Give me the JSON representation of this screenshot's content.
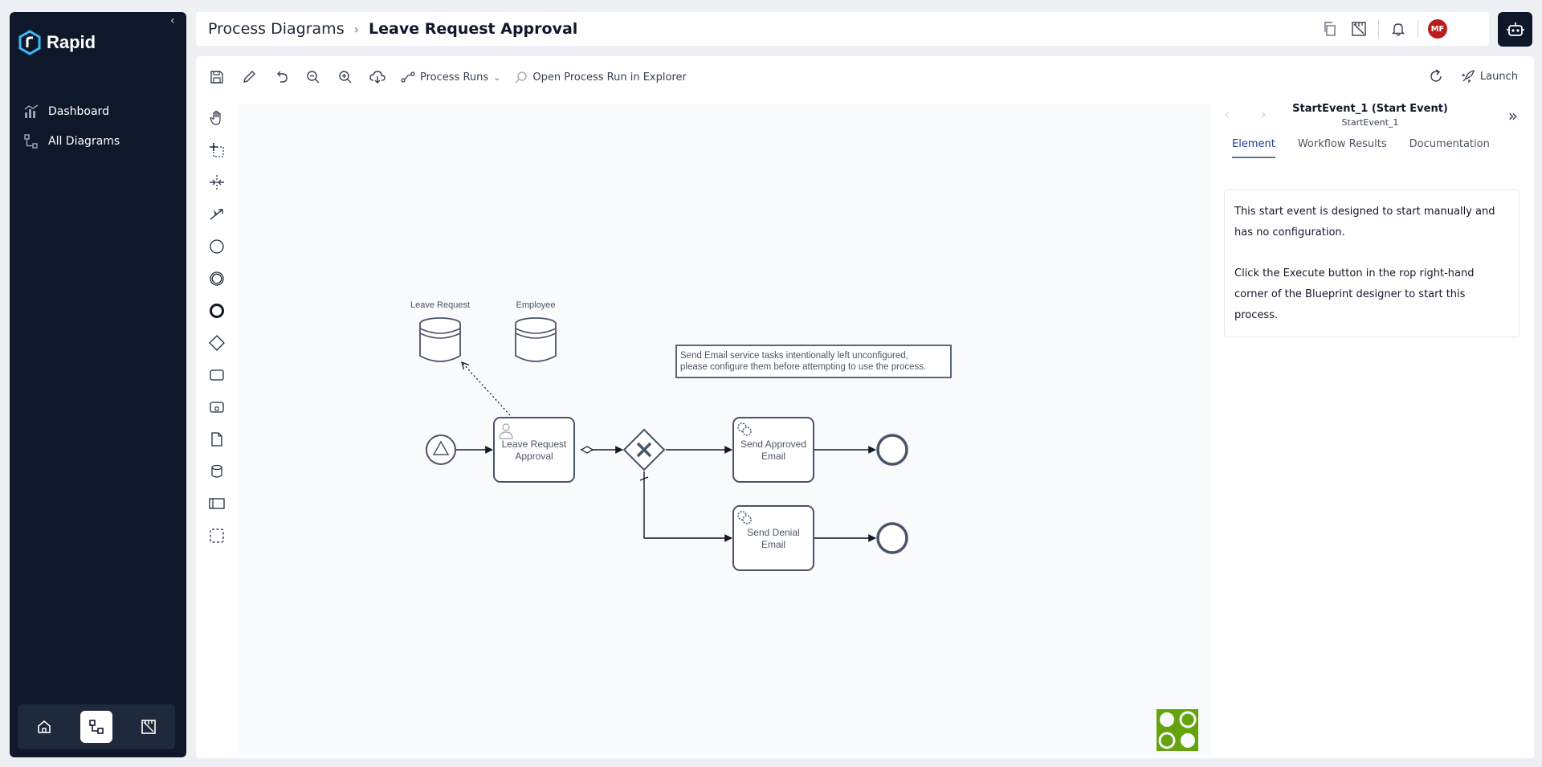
{
  "app": {
    "name": "Rapid"
  },
  "sidebar": {
    "items": [
      {
        "label": "Dashboard",
        "icon": "chart-icon"
      },
      {
        "label": "All Diagrams",
        "icon": "diagram-icon"
      }
    ],
    "bottom": [
      {
        "icon": "home-icon",
        "active": false
      },
      {
        "icon": "diagram-icon",
        "active": true
      },
      {
        "icon": "ruler-icon",
        "active": false
      }
    ]
  },
  "header": {
    "breadcrumb_parent": "Process Diagrams",
    "breadcrumb_current": "Leave Request Approval",
    "avatar_initials": "MF"
  },
  "toolbar": {
    "process_runs": "Process Runs",
    "open_in_explorer": "Open Process Run in Explorer",
    "launch": "Launch"
  },
  "diagram": {
    "data_stores": [
      {
        "label": "Leave Request"
      },
      {
        "label": "Employee"
      }
    ],
    "annotation": [
      "Send Email service tasks intentionally left unconfigured,",
      "please configure them before attempting to use the process."
    ],
    "tasks": [
      {
        "label": [
          "Leave Request",
          "Approval"
        ]
      },
      {
        "label": [
          "Send Approved",
          "Email"
        ]
      },
      {
        "label": [
          "Send Denial",
          "Email"
        ]
      }
    ]
  },
  "properties": {
    "title": "StartEvent_1 (Start Event)",
    "subtitle": "StartEvent_1",
    "tabs": [
      "Element",
      "Workflow Results",
      "Documentation"
    ],
    "active_tab": "Element",
    "description": [
      "This start event is designed to start manually and has no configuration.",
      "Click the Execute button in the rop right-hand corner of the Blueprint designer to start this process."
    ]
  },
  "colors": {
    "sidebar_bg": "#0f172a",
    "accent_logo": "#38bdf8",
    "avatar": "#b91c1c",
    "puzzle": "#65a30d"
  }
}
